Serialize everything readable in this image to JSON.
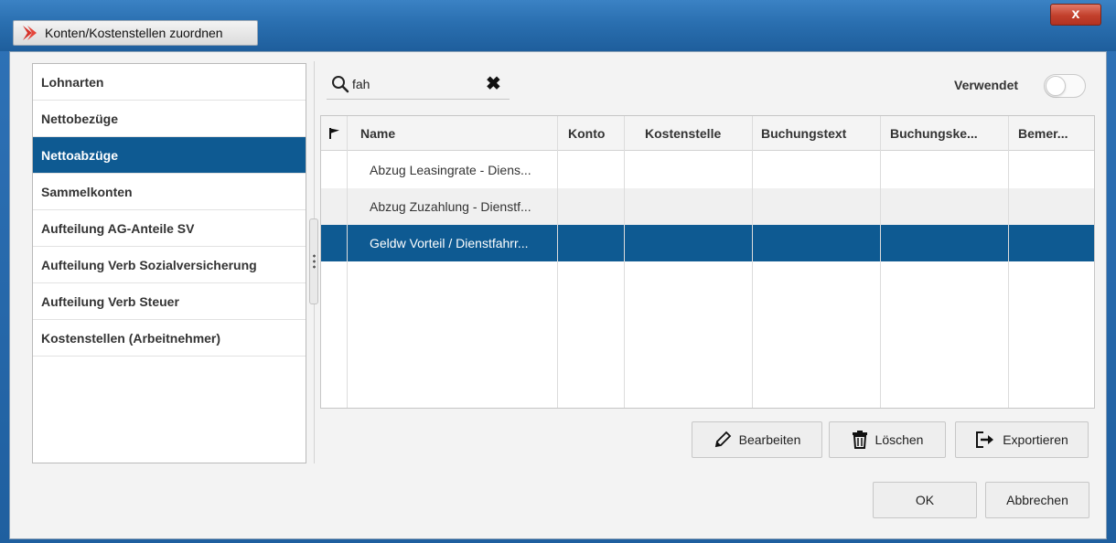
{
  "window": {
    "title": "Konten/Kostenstellen zuordnen",
    "close_glyph": "x"
  },
  "left_list": {
    "items": [
      {
        "label": "Lohnarten",
        "selected": false
      },
      {
        "label": "Nettobezüge",
        "selected": false
      },
      {
        "label": "Nettoabzüge",
        "selected": true
      },
      {
        "label": "Sammelkonten",
        "selected": false
      },
      {
        "label": "Aufteilung AG-Anteile SV",
        "selected": false
      },
      {
        "label": "Aufteilung Verb Sozialversicherung",
        "selected": false
      },
      {
        "label": "Aufteilung Verb Steuer",
        "selected": false
      },
      {
        "label": "Kostenstellen (Arbeitnehmer)",
        "selected": false
      }
    ]
  },
  "search": {
    "value": "fah",
    "icon": "search-icon",
    "clear_icon": "close-icon"
  },
  "verwendet": {
    "label": "Verwendet",
    "checked": false
  },
  "table": {
    "columns": [
      "Name",
      "Konto",
      "Kostenstelle",
      "Buchungstext",
      "Buchungske...",
      "Bemer..."
    ],
    "rows": [
      {
        "name": "Abzug Leasingrate - Diens...",
        "konto": "",
        "kostenstelle": "",
        "buchungstext": "",
        "buchungskennzeichen": "",
        "bemerkung": "",
        "selected": false
      },
      {
        "name": "Abzug Zuzahlung - Dienstf...",
        "konto": "",
        "kostenstelle": "",
        "buchungstext": "",
        "buchungskennzeichen": "",
        "bemerkung": "",
        "selected": false
      },
      {
        "name": "Geldw Vorteil / Dienstfahrr...",
        "konto": "",
        "kostenstelle": "",
        "buchungstext": "",
        "buchungskennzeichen": "",
        "bemerkung": "",
        "selected": true
      }
    ]
  },
  "actions": {
    "edit": "Bearbeiten",
    "delete": "Löschen",
    "export": "Exportieren"
  },
  "footer": {
    "ok": "OK",
    "cancel": "Abbrechen"
  },
  "colors": {
    "accent": "#0e5a92",
    "titlebar": "#2a6fb0",
    "logo": "#d6322a"
  }
}
